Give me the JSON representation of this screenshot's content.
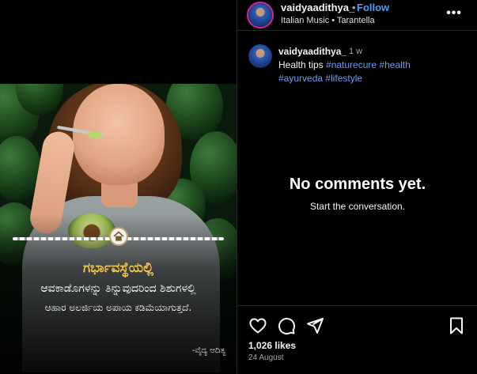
{
  "post": {
    "overlay": {
      "title": "ಗರ್ಭಾವಸ್ಥೆಯಲ್ಲಿ",
      "line1": "ಆವಕಾಡೊಗಳನ್ನು ತಿನ್ನುವುದರಿಂದ ಶಿಶುಗಳಲ್ಲಿ",
      "line2": "ಆಹಾರ ಅಲರ್ಜಿಯ ಅಪಾಯ ಕಡಿಮೆಯಾಗುತ್ತದೆ.",
      "signature": "-ವೈದ್ಯ ಆದಿತ್ಯ"
    }
  },
  "header": {
    "username": "vaidyaadithya_",
    "separator": "•",
    "follow_label": "Follow",
    "audio": "Italian Music • Tarantella",
    "more_label": "•••"
  },
  "caption": {
    "username": "vaidyaadithya_",
    "time": "1 w",
    "text_prefix": "Health tips ",
    "tags": [
      "#naturecure",
      "#health",
      "#ayurveda",
      "#lifestyle"
    ]
  },
  "comments": {
    "empty_title": "No comments yet.",
    "empty_subtitle": "Start the conversation."
  },
  "footer": {
    "likes": "1,026 likes",
    "date": "24 August"
  },
  "icons": {
    "like": "heart-icon",
    "comment": "comment-icon",
    "share": "send-icon",
    "save": "bookmark-icon",
    "more": "more-icon"
  },
  "colors": {
    "accent_link": "#4a9df8",
    "hashtag": "#6f9bf0",
    "overlay_title": "#f5c64a",
    "background": "#000000"
  }
}
